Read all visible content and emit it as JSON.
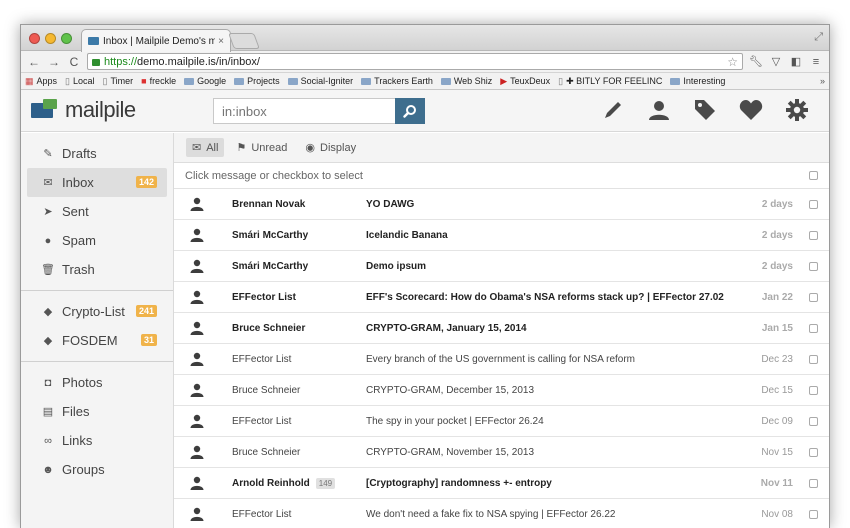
{
  "browser": {
    "tab_title": "Inbox | Mailpile Demo's m",
    "tab_close": "×",
    "url_https": "https://",
    "url_rest": "demo.mailpile.is/in/inbox/",
    "bookmarks": [
      {
        "label": "Apps",
        "icon": "apps-grid-icon"
      },
      {
        "label": "Local",
        "icon": "page-icon"
      },
      {
        "label": "Timer",
        "icon": "page-icon"
      },
      {
        "label": "freckle",
        "icon": "freckle-icon"
      },
      {
        "label": "Google",
        "icon": "folder-icon"
      },
      {
        "label": "Projects",
        "icon": "folder-icon"
      },
      {
        "label": "Social-Igniter",
        "icon": "folder-icon"
      },
      {
        "label": "Trackers Earth",
        "icon": "folder-icon"
      },
      {
        "label": "Web Shiz",
        "icon": "folder-icon"
      },
      {
        "label": "TeuxDeux",
        "icon": "teuxdeux-icon"
      },
      {
        "label": "✚ BITLY FOR FEELINC",
        "icon": "page-icon"
      },
      {
        "label": "Interesting",
        "icon": "folder-icon"
      }
    ],
    "bookmarks_more": "»"
  },
  "header": {
    "logo_text": "mailpile",
    "search_placeholder": "in:inbox"
  },
  "sidebar": {
    "group1": [
      {
        "label": "Drafts",
        "icon": "pencil-icon"
      },
      {
        "label": "Inbox",
        "icon": "inbox-icon",
        "badge": "142",
        "active": true
      },
      {
        "label": "Sent",
        "icon": "paper-plane-icon"
      },
      {
        "label": "Spam",
        "icon": "pig-icon"
      },
      {
        "label": "Trash",
        "icon": "trash-icon"
      }
    ],
    "group2": [
      {
        "label": "Crypto-List",
        "icon": "tag-icon",
        "badge": "241"
      },
      {
        "label": "FOSDEM",
        "icon": "tag-icon",
        "badge": "31"
      }
    ],
    "group3": [
      {
        "label": "Photos",
        "icon": "camera-icon"
      },
      {
        "label": "Files",
        "icon": "file-icon"
      },
      {
        "label": "Links",
        "icon": "link-icon"
      },
      {
        "label": "Groups",
        "icon": "users-icon"
      }
    ]
  },
  "filters": {
    "all": "All",
    "unread": "Unread",
    "display": "Display"
  },
  "select_hint": "Click message or checkbox to select",
  "messages": [
    {
      "from": "Brennan Novak",
      "subject": "YO DAWG",
      "date": "2 days",
      "unread": true
    },
    {
      "from": "Smári McCarthy",
      "subject": "Icelandic Banana",
      "date": "2 days",
      "unread": true
    },
    {
      "from": "Smári McCarthy",
      "subject": "Demo ipsum",
      "date": "2 days",
      "unread": true
    },
    {
      "from": "EFFector List",
      "subject": "EFF's Scorecard: How do Obama's NSA reforms stack up? | EFFector 27.02",
      "date": "Jan 22",
      "unread": true
    },
    {
      "from": "Bruce Schneier",
      "subject": "CRYPTO-GRAM, January 15, 2014",
      "date": "Jan 15",
      "unread": true
    },
    {
      "from": "EFFector List",
      "subject": "Every branch of the US government is calling for NSA reform",
      "date": "Dec 23",
      "unread": false
    },
    {
      "from": "Bruce Schneier",
      "subject": "CRYPTO-GRAM, December 15, 2013",
      "date": "Dec 15",
      "unread": false
    },
    {
      "from": "EFFector List",
      "subject": "The spy in your pocket | EFFector 26.24",
      "date": "Dec 09",
      "unread": false
    },
    {
      "from": "Bruce Schneier",
      "subject": "CRYPTO-GRAM, November 15, 2013",
      "date": "Nov 15",
      "unread": false
    },
    {
      "from": "Arnold Reinhold",
      "count": "149",
      "subject": "[Cryptography] randomness +- entropy",
      "date": "Nov 11",
      "unread": true
    },
    {
      "from": "EFFector List",
      "subject": "We don't need a fake fix to NSA spying | EFFector 26.22",
      "date": "Nov 08",
      "unread": false
    }
  ],
  "colors": {
    "accent": "#3e6e8e",
    "badge": "#f0b34a",
    "logo_blue": "#2d5f8a",
    "logo_green": "#5aa34b"
  }
}
